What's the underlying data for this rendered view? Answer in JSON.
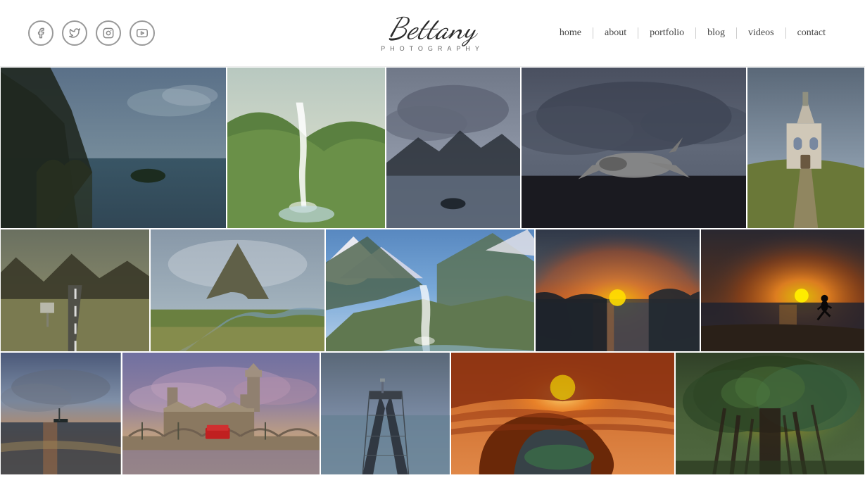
{
  "header": {
    "logo": {
      "script_text": "Bettany",
      "subtitle": "PHOTOGRAPHY"
    },
    "social": [
      {
        "name": "facebook",
        "icon": "f",
        "label": "Facebook"
      },
      {
        "name": "twitter",
        "icon": "t",
        "label": "Twitter"
      },
      {
        "name": "instagram",
        "icon": "i",
        "label": "Instagram"
      },
      {
        "name": "youtube",
        "icon": "▶",
        "label": "YouTube"
      }
    ],
    "nav": [
      {
        "label": "home",
        "id": "home"
      },
      {
        "label": "about",
        "id": "about"
      },
      {
        "label": "portfolio",
        "id": "portfolio"
      },
      {
        "label": "blog",
        "id": "blog"
      },
      {
        "label": "videos",
        "id": "videos"
      },
      {
        "label": "contact",
        "id": "contact"
      }
    ]
  },
  "gallery": {
    "row1": [
      {
        "id": "cliff",
        "alt": "Coastal cliff landscape",
        "class": "cliff-photo"
      },
      {
        "id": "waterfall",
        "alt": "Waterfall in green valley",
        "class": "waterfall-photo"
      },
      {
        "id": "lake",
        "alt": "Lake with storm clouds",
        "class": "lake-photo"
      },
      {
        "id": "storm",
        "alt": "Plane wreck on black sand beach",
        "class": "storm-photo"
      },
      {
        "id": "church",
        "alt": "Church on cobblestone path",
        "class": "church-photo"
      }
    ],
    "row2": [
      {
        "id": "road",
        "alt": "Road through Icelandic landscape",
        "class": "road-photo"
      },
      {
        "id": "mountain",
        "alt": "Kirkjufell mountain with river",
        "class": "mountain-photo"
      },
      {
        "id": "alpine",
        "alt": "Alpine mountain valley with waterfall",
        "class": "alpine-photo"
      },
      {
        "id": "sunset",
        "alt": "Sunset over rocky coastline",
        "class": "sunset-photo"
      },
      {
        "id": "runner",
        "alt": "Silhouette runner at sunset",
        "class": "runner-photo"
      }
    ],
    "row3": [
      {
        "id": "ocean",
        "alt": "Ocean sunset",
        "class": "ocean-photo"
      },
      {
        "id": "london",
        "alt": "London Westminster Bridge",
        "class": "london-photo"
      },
      {
        "id": "pier",
        "alt": "Pier at dusk",
        "class": "pier-photo"
      },
      {
        "id": "horseshoe",
        "alt": "Horseshoe Bend canyon",
        "class": "horseshoe-photo"
      },
      {
        "id": "tree",
        "alt": "Banyan tree in sunlight",
        "class": "tree-photo"
      }
    ]
  }
}
